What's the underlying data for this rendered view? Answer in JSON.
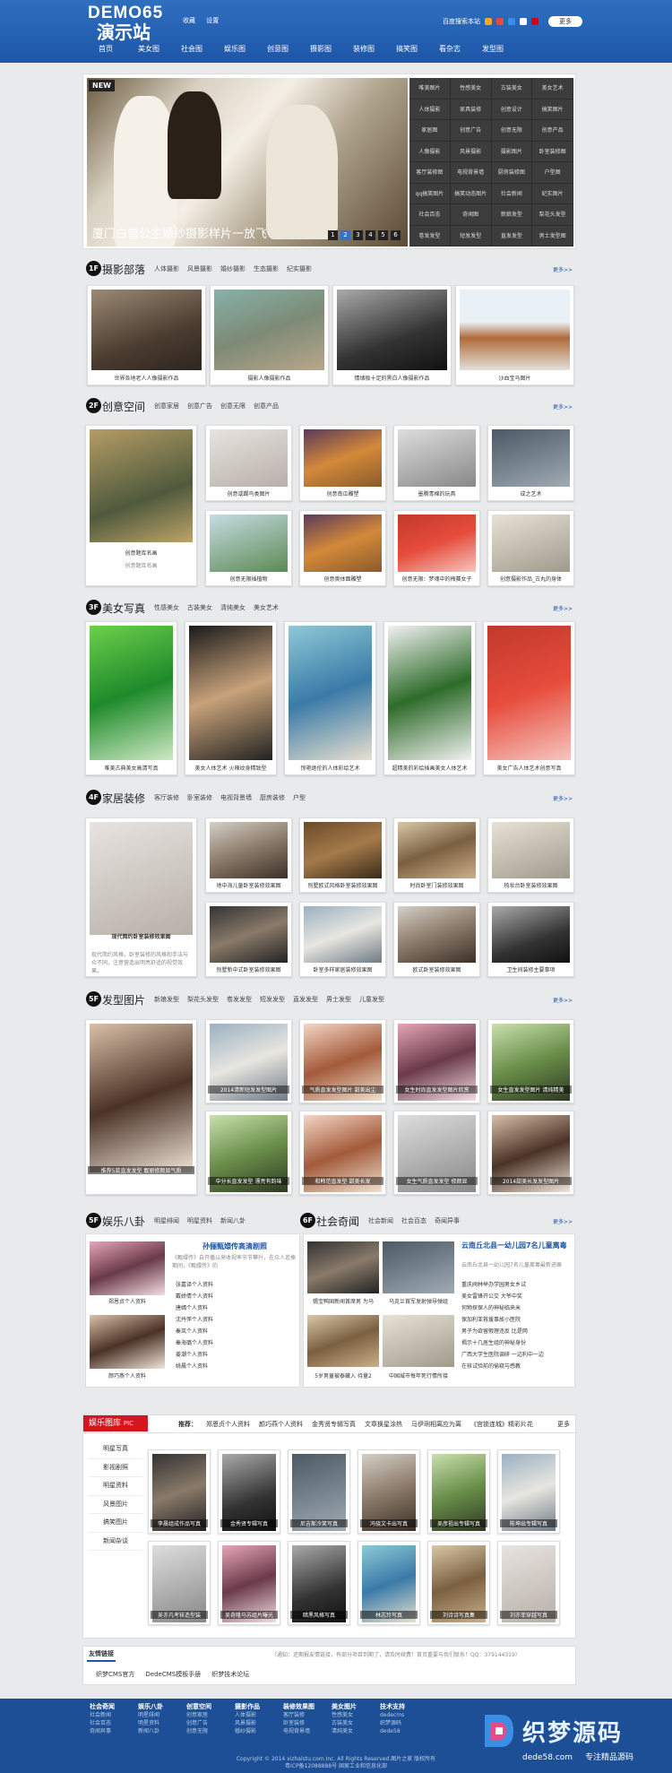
{
  "header": {
    "logo_line1": "DEMO65",
    "logo_line2": "演示站",
    "top_links": [
      "收藏",
      "设置"
    ],
    "right_text": "百度搜索本站",
    "more": "更多"
  },
  "nav": [
    "首页",
    "美女图",
    "社会图",
    "娱乐图",
    "创意图",
    "摄影图",
    "装修图",
    "搞笑图",
    "看杂志",
    "发型图"
  ],
  "banner": {
    "badge": "NEW",
    "caption": "厦门白雪公主婚纱摄影样片一放飞",
    "pages": [
      "1",
      "2",
      "3",
      "4",
      "5",
      "6"
    ],
    "active_page": "2",
    "tags": [
      "唯美图片",
      "性感美女",
      "古装美女",
      "美女艺术",
      "人体摄影",
      "家具装修",
      "创意设计",
      "搞笑图片",
      "家居图",
      "创意广告",
      "创意无限",
      "创意产品",
      "人像摄影",
      "风景摄影",
      "摄影图片",
      "卧室装修图",
      "客厅装修图",
      "电视背景墙",
      "厨房装修图",
      "户型图",
      "qq搞笑图片",
      "搞笑动态图片",
      "社会新闻",
      "纪实图片",
      "社会百态",
      "奇闻图",
      "新娘发型",
      "梨花头发型",
      "卷发发型",
      "短发发型",
      "直发发型",
      "男士发型图"
    ]
  },
  "sec1": {
    "floor": "1F",
    "title": "摄影部落",
    "tabs": [
      "人体摄影",
      "风景摄影",
      "婚纱摄影",
      "生态摄影",
      "纪实摄影"
    ],
    "more": "更多>>",
    "items": [
      "世界各地老人人像摄影作品",
      "摄影人像摄影作品",
      "情绪极十足的黑白人像摄影作品",
      "沙血宝马图片"
    ]
  },
  "sec2": {
    "floor": "2F",
    "title": "创意空间",
    "tabs": [
      "创意家居",
      "创意广告",
      "创意无限",
      "创意产品"
    ],
    "more": "更多>>",
    "featured": "创意题库名画",
    "featured_desc": "创意题库名画",
    "items": [
      "创意或踢鸟类图片",
      "创意南瓜雕塑",
      "墨腾青棉的玩具",
      "成之艺术",
      "创意无限插植物",
      "创意奥体面雕塑",
      "创意无限：梦魂中的梅赛女子",
      "创意摄影作品_古丸的身体"
    ]
  },
  "sec3": {
    "floor": "3F",
    "title": "美女写真",
    "tabs": [
      "性感美女",
      "古装美女",
      "清纯美女",
      "美女艺术"
    ],
    "more": "更多>>",
    "items": [
      "唯美古典美女高清写真",
      "美女人体艺术 火辣纹身精致型",
      "惊艳绝伦的人体彩绘艺术",
      "超精美的彩绘插画美女人体艺术",
      "美女广告人体艺术创意写真"
    ]
  },
  "sec4": {
    "floor": "4F",
    "title": "家居装修",
    "tabs": [
      "客厅装修",
      "卧室装修",
      "电视背景墙",
      "厨房装修",
      "户型"
    ],
    "more": "更多>>",
    "featured": "现代简约卧室装修效果图",
    "featured_desc": "现代简约风格，卧室装修的风格和手法与众不同，注意营造出明亮舒适的视觉效果。",
    "items": [
      "地中海儿童卧室装修效果图",
      "别墅欧式风格卧室装修效果图",
      "时尚卧室门装修效果图",
      "梳妆台卧室装修效果图",
      "别墅新中式卧室装修效果图",
      "卧室多样家居装修效果图",
      "欧式卧室装修效果图",
      "卫生间装修主要事项"
    ]
  },
  "sec5": {
    "floor": "5F",
    "title": "发型图片",
    "tabs": [
      "新娘发型",
      "梨花头发型",
      "卷发发型",
      "短发发型",
      "直发发型",
      "男士发型",
      "儿童发型"
    ],
    "more": "更多>>",
    "featured": "推荐5款直发发型 靓丽修颜显气质",
    "items": [
      "2014清新短发发型图片",
      "气质直发发型图片 甜美出尘",
      "女生时尚直发发型图片欣赏",
      "女生直发发型图片 清纯精美",
      "中分长直发发型 漂亮有韵味",
      "和韩范直发型 甜美长发",
      "女生气质直发发型 修颜显",
      "2014甜美长发发型图片"
    ]
  },
  "sec6": {
    "floor": "5F",
    "title": "娱乐八卦",
    "tabs": [
      "明星绯闻",
      "明星资料",
      "新闻八卦"
    ],
    "more": "更多>>",
    "headline": "孙俪甄嬛传高清剧照",
    "summary": "《甄嬛传》自开播以来收视率节节攀升，在众人追捧期间，《甄嬛传》的",
    "thumbs": [
      "郑恩贞个人资料",
      "颜巧燕个人资料"
    ],
    "list": [
      "张嘉译个人资料",
      "戴娇倩个人资料",
      "唐嫣个人资料",
      "沈丹萍个人资料",
      "秦岚个人资料",
      "秦海璐个人资料",
      "姜潮个人资料",
      "姚晨个人资料"
    ]
  },
  "sec7": {
    "floor": "6F",
    "title": "社会奇闻",
    "tabs": [
      "社会新闻",
      "社会百态",
      "奇闻异事"
    ],
    "more": "更多>>",
    "thumbs": [
      "锡宝鸭国新闻首席男 为马",
      "乌克兰首军发射弹导弹组",
      "5岁男童被泰藏入 待量2",
      "中国城市每年死行情所接"
    ],
    "headline": "云南丘北县一幼儿园7名儿童离毒",
    "summary": "云南丘北县一幼儿园7名儿童离毒最新进展",
    "list": [
      "重庆阀林举办学园男女乡试",
      "美女雷锋开公交 大爷中奖",
      "何物探保人的神秘临来米",
      "保加利亚救援事故小医院",
      "男子为欲留假理违反 比是网",
      "揭示十几居生组的神秘身份",
      "广西大学生医院调研 一边利中一边",
      "在核试验前的偷窥与感教"
    ]
  },
  "gallery": {
    "title": "娱乐图库",
    "tag": "PIC",
    "recommend_label": "推荐：",
    "recommend": [
      "郑恩贞个人资料",
      "颜巧燕个人资料",
      "金秀贤专辑写真",
      "文章换星涂热",
      "马伊琍相离应为离",
      "《宫锁连城》精彩片花"
    ],
    "more": "更多",
    "side": [
      "明星写真",
      "影视剧照",
      "明星资料",
      "风景图片",
      "搞笑图片",
      "新闻杂谈"
    ],
    "row1": [
      "李晨组成作品写真",
      "金秀贤专辑写真",
      "尼吉斯冷笑写真",
      "冯骁文卡出写真",
      "吴彦祖出专辑写真",
      "陈坤出专辑写真"
    ],
    "row2": [
      "吴亦凡考核造型装",
      "吴奇隆马苏组片曝光",
      "暗黑风格写真",
      "林志玲写真",
      "刘诗诗写真集",
      "刘亦菲穿越写真"
    ]
  },
  "links": {
    "title": "友情链接",
    "items": [
      "织梦CMS官方",
      "DedeCMS模板手册",
      "织梦技术论坛"
    ],
    "notice": "（通知：还期报友情链接，有部分项目到期了，请及时续费！首页重要与我们联系！QQ：379144319）"
  },
  "footer": {
    "cols": [
      {
        "title": "社会奇闻",
        "items": [
          "社会新闻",
          "社会百态",
          "奇闻异事"
        ]
      },
      {
        "title": "娱乐八卦",
        "items": [
          "明星绯闻",
          "明星资料",
          "新闻八卦"
        ]
      },
      {
        "title": "创意空间",
        "items": [
          "创意家居",
          "创意广告",
          "创意无限"
        ]
      },
      {
        "title": "摄影作品",
        "items": [
          "人体摄影",
          "风景摄影",
          "婚纱摄影"
        ]
      },
      {
        "title": "装修效果图",
        "items": [
          "客厅装修",
          "卧室装修",
          "电视背景墙"
        ]
      },
      {
        "title": "美女图片",
        "items": [
          "性感美女",
          "古装美女",
          "清纯美女"
        ]
      },
      {
        "title": "技术支持",
        "items": [
          "dedecms",
          "织梦源码",
          "dede58"
        ]
      }
    ],
    "copyright": "Copyright © 2014 xizhalstu.com.Inc. All Rights Reserved.图片之家 版权所有",
    "icp": "粤ICP备12088888号    国家工业和信息化部"
  },
  "watermark": {
    "brand": "织梦源码",
    "site": "dede58.com",
    "slogan": "专注精品源码"
  }
}
